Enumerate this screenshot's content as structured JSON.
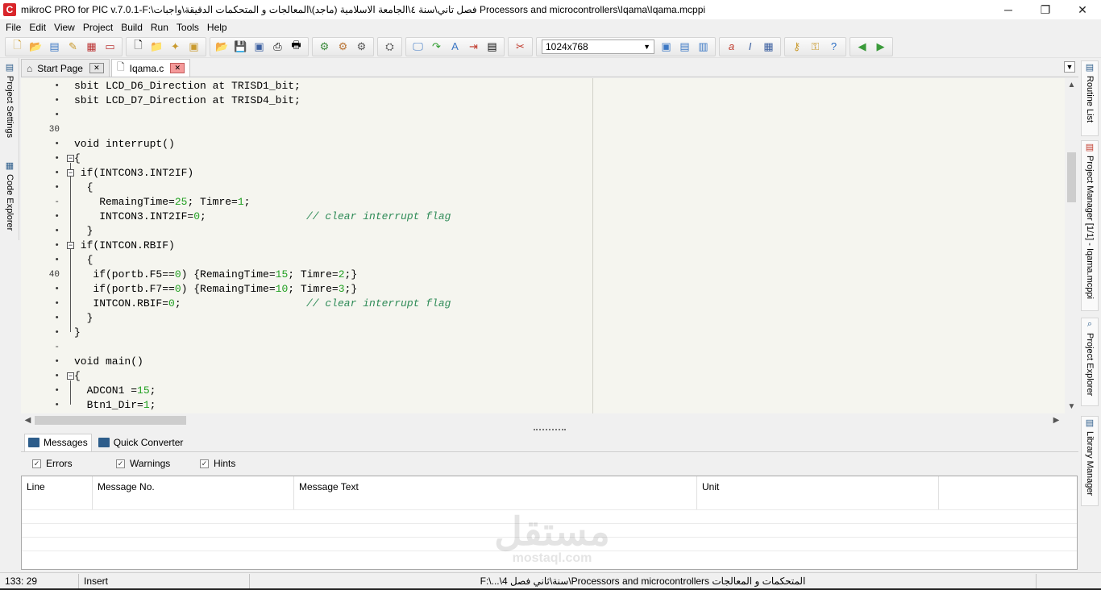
{
  "window": {
    "title": "mikroC PRO for PIC v.7.0.1-F:\\فصل تاني\\سنة ٤\\الجامعة الاسلامية (ماجد)\\المعالجات و المتحكمات الدقيقة\\واجبات Processors and microcontrollers\\Iqama\\Iqama.mcppi",
    "minimize": "─",
    "maximize": "❐",
    "close": "✕"
  },
  "menu": {
    "file": "File",
    "edit": "Edit",
    "view": "View",
    "project": "Project",
    "build": "Build",
    "run": "Run",
    "tools": "Tools",
    "help": "Help"
  },
  "toolbar": {
    "resolution": "1024x768"
  },
  "left_dock": {
    "project_settings": "Project Settings",
    "code_explorer": "Code Explorer"
  },
  "right_dock": {
    "routine_list": "Routine List",
    "project_manager": "Project Manager [1/1] - Iqama.mcppi",
    "project_explorer": "Project Explorer",
    "library_manager": "Library Manager"
  },
  "editor_tabs": [
    {
      "label": "Start Page"
    },
    {
      "label": "Iqama.c"
    }
  ],
  "code": {
    "lines": [
      {
        "marker": "•",
        "text": "sbit LCD_D6_Direction at TRISD1_bit;"
      },
      {
        "marker": "•",
        "text": "sbit LCD_D7_Direction at TRISD4_bit;"
      },
      {
        "marker": "•",
        "text": ""
      },
      {
        "marker": "30",
        "text": ""
      },
      {
        "marker": "•",
        "text": "void interrupt()"
      },
      {
        "marker": "•",
        "text": "{"
      },
      {
        "marker": "•",
        "text": " if(INTCON3.INT2IF)"
      },
      {
        "marker": "•",
        "text": "  {"
      },
      {
        "marker": "-",
        "text": "    RemaingTime=25; Timre=1;"
      },
      {
        "marker": "•",
        "text": "    INTCON3.INT2IF=0;",
        "comment": "// clear interrupt flag"
      },
      {
        "marker": "•",
        "text": "  }"
      },
      {
        "marker": "•",
        "text": " if(INTCON.RBIF)"
      },
      {
        "marker": "•",
        "text": "  {"
      },
      {
        "marker": "40",
        "text": "   if(portb.F5==0) {RemaingTime=15; Timre=2;}"
      },
      {
        "marker": "•",
        "text": "   if(portb.F7==0) {RemaingTime=10; Timre=3;}"
      },
      {
        "marker": "•",
        "text": "   INTCON.RBIF=0;",
        "comment": "// clear interrupt flag"
      },
      {
        "marker": "•",
        "text": "  }"
      },
      {
        "marker": "•",
        "text": "}"
      },
      {
        "marker": "-",
        "text": ""
      },
      {
        "marker": "•",
        "text": "void main()"
      },
      {
        "marker": "•",
        "text": "{"
      },
      {
        "marker": "•",
        "text": "  ADCON1 =15;"
      },
      {
        "marker": "•",
        "text": "  Btn1_Dir=1;"
      }
    ]
  },
  "messages": {
    "tab_messages": "Messages",
    "tab_quick_converter": "Quick Converter",
    "filter_errors": "Errors",
    "filter_warnings": "Warnings",
    "filter_hints": "Hints",
    "col_line": "Line",
    "col_message_no": "Message No.",
    "col_message_text": "Message Text",
    "col_unit": "Unit"
  },
  "watermark": {
    "arabic": "مستقل",
    "latin": "mostaql.com"
  },
  "status": {
    "position": "133: 29",
    "mode": "Insert",
    "path": "F:\\...\\4 سنة\\ثاني فصل\\Processors and microcontrollers المتحكمات و المعالجات"
  },
  "colors": {
    "editor_bg": "#f5f5ef",
    "number": "#22a022",
    "comment": "#2e8b57",
    "app_icon": "#d9262b"
  }
}
